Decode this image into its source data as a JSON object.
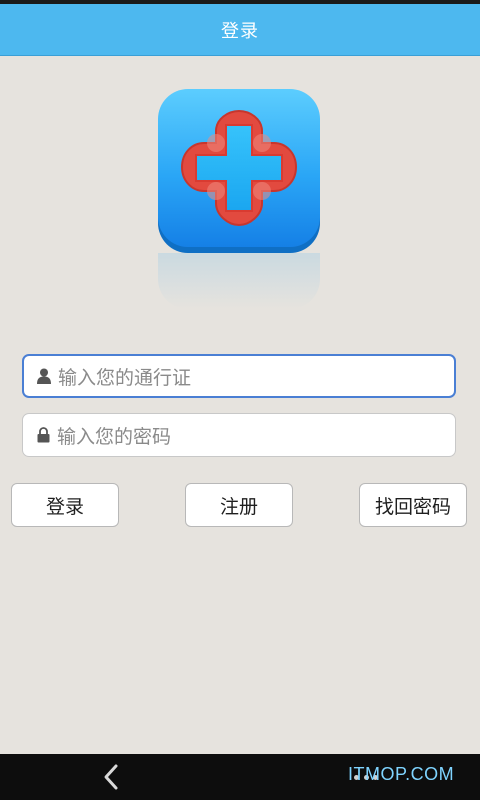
{
  "header": {
    "title": "登录"
  },
  "logo": {
    "icon": "red-cross-medical-icon",
    "colors": {
      "tile_top": "#4fc8ff",
      "tile_bottom": "#1e8ff0",
      "cross_border": "#e24a3f",
      "cross_fill": "#1fb4f5"
    }
  },
  "form": {
    "username_placeholder": "输入您的通行证",
    "password_placeholder": "输入您的密码"
  },
  "buttons": {
    "login": "登录",
    "register": "注册",
    "forgot_password": "找回密码"
  },
  "navbar": {
    "watermark": "ITMOP.COM"
  },
  "colors": {
    "accent": "#4db8ef",
    "background": "#e6e3de",
    "focus_border": "#4a7fd4"
  }
}
